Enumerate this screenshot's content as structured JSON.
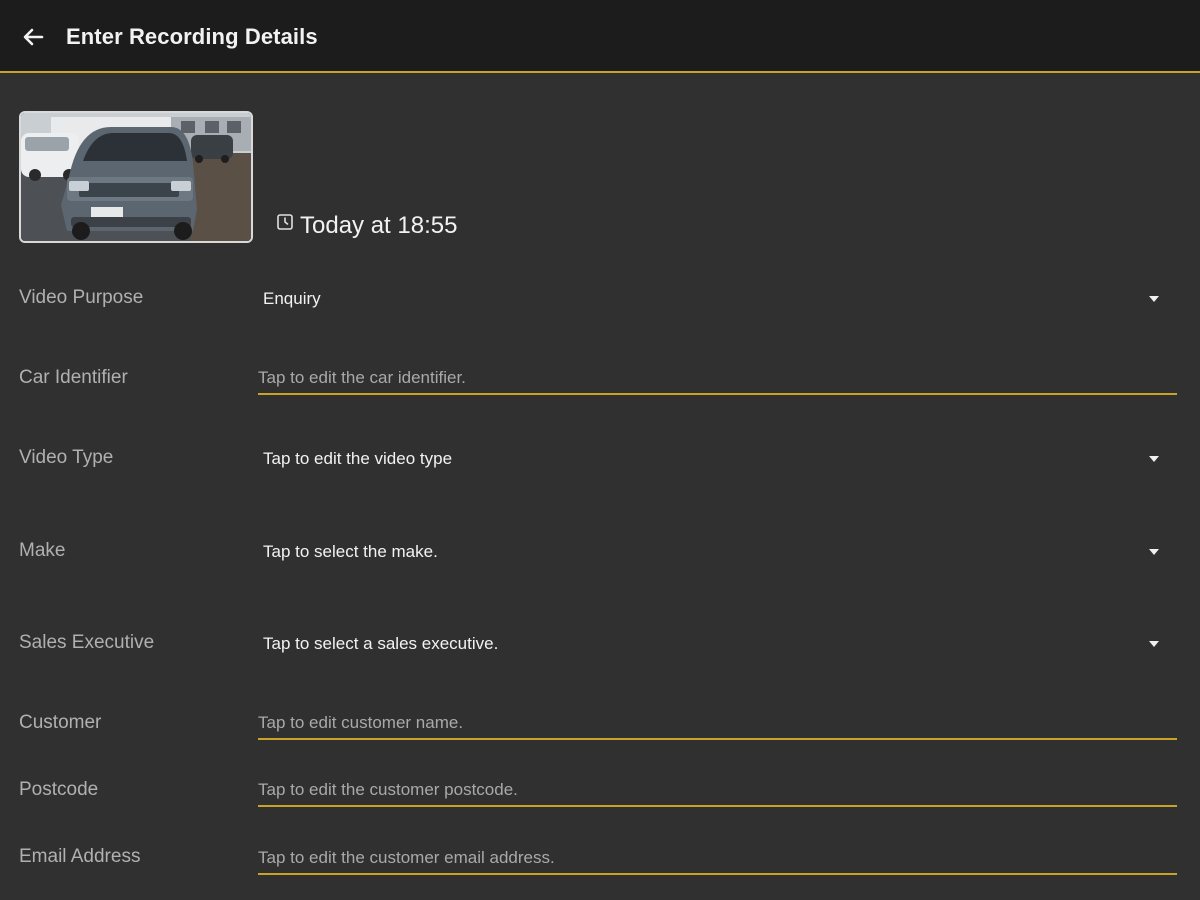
{
  "app_bar": {
    "title": "Enter Recording Details",
    "back_icon": "arrow-back-icon",
    "background": "#1c1c1c",
    "accent": "#c9a227"
  },
  "recording": {
    "thumbnail_alt": "car video thumbnail",
    "timestamp_icon": "clock-icon",
    "timestamp": "Today at 18:55"
  },
  "form": {
    "video_purpose": {
      "label": "Video Purpose",
      "value": "Enquiry"
    },
    "car_identifier": {
      "label": "Car Identifier",
      "placeholder": "Tap to edit the car identifier."
    },
    "video_type": {
      "label": "Video Type",
      "value": "Tap to edit the video type"
    },
    "make": {
      "label": "Make",
      "value": "Tap to select the make."
    },
    "sales_executive": {
      "label": "Sales Executive",
      "value": "Tap to select a sales executive."
    },
    "customer": {
      "label": "Customer",
      "placeholder": "Tap to edit customer name."
    },
    "postcode": {
      "label": "Postcode",
      "placeholder": "Tap to edit the customer postcode."
    },
    "email_address": {
      "label": "Email Address",
      "placeholder": "Tap to edit the customer email address."
    }
  }
}
